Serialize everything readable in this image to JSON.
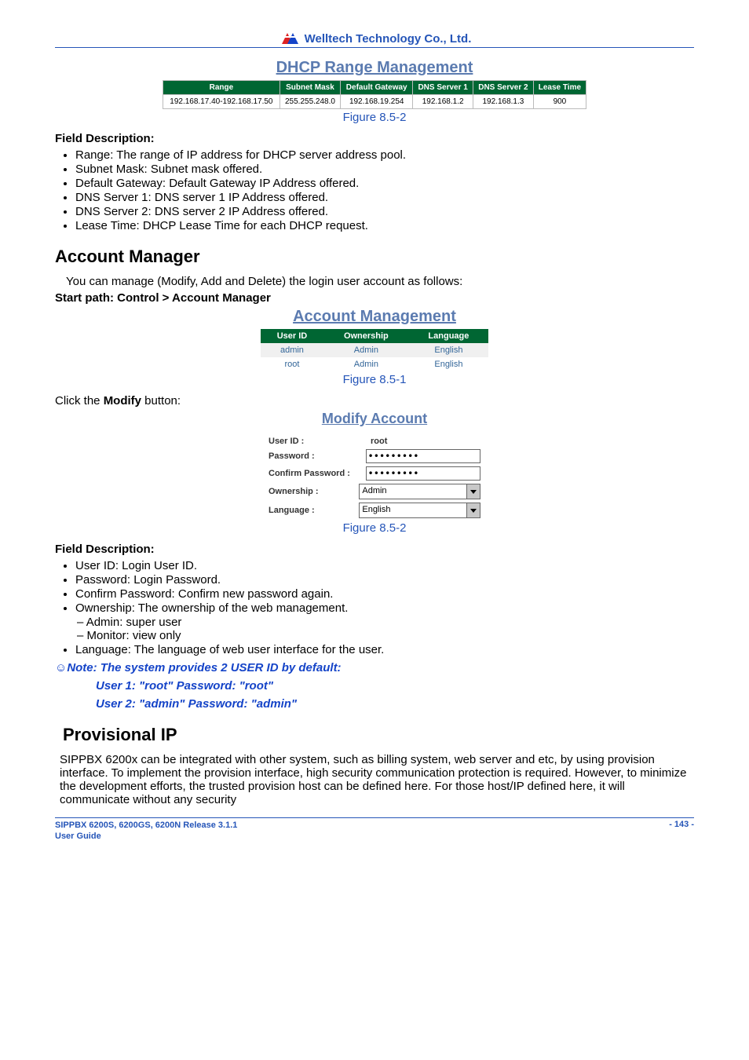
{
  "header": {
    "company": "Welltech Technology Co., Ltd."
  },
  "dhcp_panel": {
    "title": "DHCP Range Management",
    "cols": [
      "Range",
      "Subnet Mask",
      "Default Gateway",
      "DNS Server 1",
      "DNS Server 2",
      "Lease Time"
    ],
    "row": [
      "192.168.17.40-192.168.17.50",
      "255.255.248.0",
      "192.168.19.254",
      "192.168.1.2",
      "192.168.1.3",
      "900"
    ],
    "figure": "Figure 8.5-2"
  },
  "field_desc1": {
    "heading": "Field Description:",
    "items": [
      "Range: The range of IP address for DHCP server address pool.",
      "Subnet Mask: Subnet mask offered.",
      "Default Gateway: Default Gateway IP Address offered.",
      "DNS Server 1: DNS server 1 IP Address offered.",
      "DNS Server 2: DNS server 2 IP Address offered.",
      "Lease Time: DHCP Lease Time for each DHCP request."
    ]
  },
  "account_manager": {
    "heading": "Account Manager",
    "intro": "You can manage (Modify, Add and Delete) the login user account as follows:",
    "start_path_label": "Start path:",
    "start_path_value": "Control > Account Manager"
  },
  "acct_panel": {
    "title": "Account Management",
    "cols": [
      "User ID",
      "Ownership",
      "Language"
    ],
    "rows": [
      [
        "admin",
        "Admin",
        "English"
      ],
      [
        "root",
        "Admin",
        "English"
      ]
    ],
    "figure": "Figure 8.5-1"
  },
  "click_modify_prefix": "Click the ",
  "click_modify_bold": "Modify",
  "click_modify_suffix": " button:",
  "modify_panel": {
    "title": "Modify Account",
    "user_id_label": "User ID :",
    "user_id_value": "root",
    "password_label": "Password :",
    "password_value": "•••••••••",
    "confirm_label": "Confirm Password :",
    "confirm_value": "•••••••••",
    "ownership_label": "Ownership :",
    "ownership_value": "Admin",
    "language_label": "Language :",
    "language_value": "English",
    "figure": "Figure 8.5-2"
  },
  "field_desc2": {
    "heading": "Field Description:",
    "items": [
      "User ID: Login User ID.",
      "Password: Login Password.",
      "Confirm Password: Confirm new password again.",
      "Ownership: The ownership of the web management."
    ],
    "sub_items": [
      "Admin: super user",
      "Monitor: view only"
    ],
    "items_after": [
      "Language: The language of web user interface for the user."
    ]
  },
  "note": {
    "line1": "☺Note: The system provides 2 USER ID by default:",
    "line2": "User 1: \"root\" Password: \"root\"",
    "line3": "User 2: \"admin\" Password: \"admin\""
  },
  "provisional": {
    "heading": "Provisional IP",
    "body": "SIPPBX 6200x can be integrated with other system, such as billing system, web server and etc, by using provision interface. To implement the provision interface, high security communication protection is required. However, to minimize the development efforts, the trusted provision host can be defined here. For those host/IP defined here, it will communicate without any security"
  },
  "footer": {
    "left": "SIPPBX 6200S, 6200GS, 6200N Release 3.1.1\nUser Guide",
    "page": "- 143 -"
  }
}
